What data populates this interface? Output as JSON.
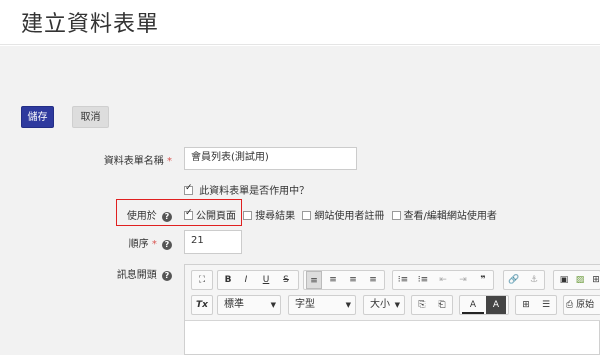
{
  "page": {
    "title": "建立資料表單"
  },
  "actions": {
    "save_label": "儲存",
    "cancel_label": "取消"
  },
  "form": {
    "name_label": "資料表單名稱",
    "name_required": "*",
    "name_value": "會員列表(測試用)",
    "active_label": "此資料表單是否作用中？",
    "usage_label": "使用於",
    "usage_options": [
      {
        "label": "公開頁面",
        "checked": true
      },
      {
        "label": "搜尋結果",
        "checked": false
      },
      {
        "label": "網站使用者註冊",
        "checked": false
      },
      {
        "label": "查看/編輯網站使用者",
        "checked": false
      }
    ],
    "order_label": "順序",
    "order_required": "*",
    "order_value": "21",
    "message_label": "訊息開頭"
  },
  "editor": {
    "row1": [
      "⛶",
      "B",
      "I",
      "U",
      "S",
      "≡",
      "≡",
      "≡",
      "≡",
      "⁝≡",
      "⁝≡",
      "⇤",
      "⇥",
      "❞",
      "🔗",
      "⚓",
      "▣",
      "▨",
      "⊞"
    ],
    "row2": {
      "clear_format": "Tx",
      "format_combo": "標準",
      "font_combo": "字型",
      "size_combo": "大小",
      "paste_text": "⎘",
      "paste_word": "⎗",
      "text_color": "A",
      "bg_color": "A",
      "table": "⊞",
      "hr": "☰",
      "source_label": "原始"
    }
  }
}
